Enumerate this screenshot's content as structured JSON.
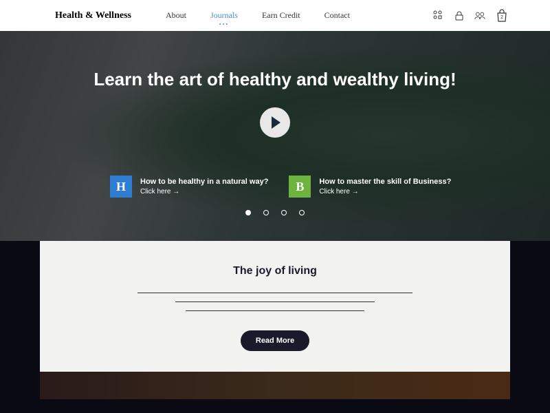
{
  "header": {
    "brand": "Health & Wellness",
    "nav": [
      "About",
      "Journals",
      "Earn Credit",
      "Contact"
    ],
    "activeIndex": 1,
    "bagCount": "2"
  },
  "hero": {
    "title": "Learn the art of healthy and wealthy living!",
    "cards": [
      {
        "badge": "H",
        "title": "How to be healthy in a natural way?",
        "link": "Click here"
      },
      {
        "badge": "B",
        "title": "How to master the skill of Business?",
        "link": "Click here"
      }
    ],
    "dotsCount": 4,
    "activeDot": 0
  },
  "section": {
    "title": "The joy of living",
    "button": "Read More"
  }
}
